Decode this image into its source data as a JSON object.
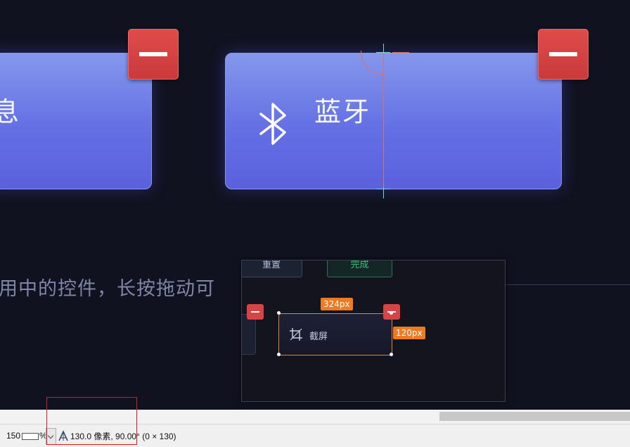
{
  "main": {
    "tile_left_label": "息",
    "tile_right_label": "蓝牙",
    "hint_text": "用中的控件，长按拖动可"
  },
  "preview": {
    "reset_label": "重置",
    "done_label": "完成",
    "tile_label": "截屏",
    "width_badge": "324px",
    "height_badge": "120px"
  },
  "status_bar": {
    "zoom_value": "150",
    "zoom_unit": "%",
    "measure_text": "130.0 像素, 90.00° (0 × 130)"
  },
  "colors": {
    "tile_gradient_top": "#8597ec",
    "tile_gradient_bottom": "#5b60de",
    "remove_red": "#d64545",
    "badge_orange": "#ee7a21",
    "done_green": "#35c878",
    "background": "#111220"
  },
  "icons": [
    "bluetooth-icon",
    "remove-icon",
    "crop-icon",
    "zoom-ruler-icon",
    "chevron-down-icon",
    "measure-angle-icon"
  ]
}
